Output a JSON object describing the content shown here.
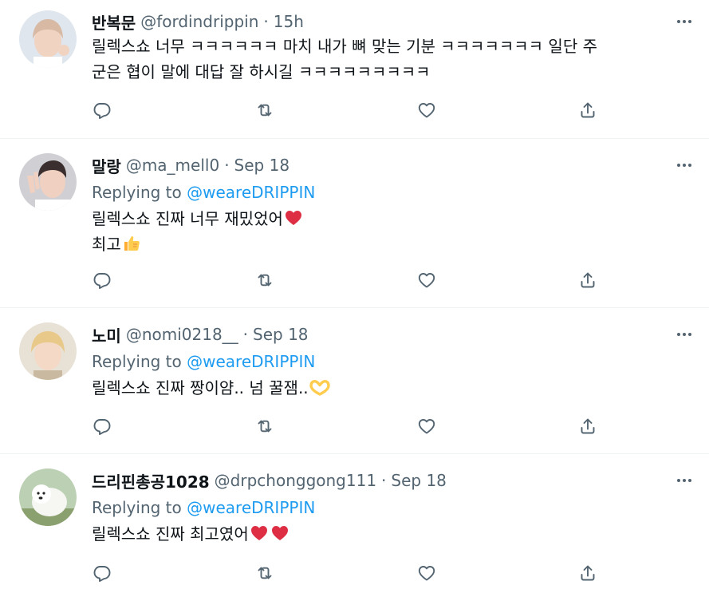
{
  "colors": {
    "text": "#0f1419",
    "muted": "#536471",
    "link": "#1d9bf0",
    "heart": "#e0245e",
    "divider": "#eff3f4"
  },
  "icons": {
    "more": "more-icon",
    "reply": "reply-icon",
    "retweet": "retweet-icon",
    "like": "like-icon",
    "share": "share-icon"
  },
  "tweets": [
    {
      "name": "반복문",
      "handle": "@fordindrippin",
      "sep": "·",
      "time": "15h",
      "lines": [
        "릴렉스쇼 너무 ㅋㅋㅋㅋㅋㅋ 마치 내가 뼈 맞는 기분 ㅋㅋㅋㅋㅋㅋㅋ 일단 주",
        "군은 협이 말에 대답 잘 하시길 ㅋㅋㅋㅋㅋㅋㅋㅋㅋ"
      ]
    },
    {
      "name": "말랑",
      "handle": "@ma_mell0",
      "sep": "·",
      "time": "Sep 18",
      "replying_label": "Replying to",
      "replying_to": "@weareDRIPPIN",
      "lines": [
        "릴렉스쇼 진짜 너무 재밌었어",
        "최고"
      ],
      "emojis": [
        "heart-emoji",
        "thumbs-up-emoji"
      ]
    },
    {
      "name": "노미",
      "handle": "@nomi0218__",
      "sep": "·",
      "time": "Sep 18",
      "replying_label": "Replying to",
      "replying_to": "@weareDRIPPIN",
      "lines": [
        "릴렉스쇼 진짜 짱이얌.. 넘 꿀잼.."
      ],
      "emojis": [
        "heart-hands-emoji"
      ]
    },
    {
      "name": "드리핀총공1028",
      "handle": "@drpchonggong111",
      "sep": "·",
      "time": "Sep 18",
      "replying_label": "Replying to",
      "replying_to": "@weareDRIPPIN",
      "lines": [
        "릴렉스쇼 진짜 최고였어"
      ],
      "emojis": [
        "heart-emoji",
        "heart-emoji"
      ]
    }
  ]
}
